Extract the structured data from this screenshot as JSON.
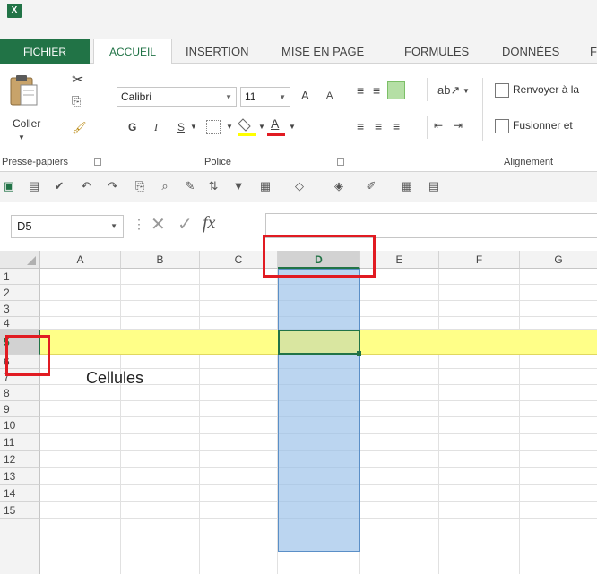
{
  "app": {
    "logo_text": "X"
  },
  "tabs": [
    {
      "label": "FICHIER"
    },
    {
      "label": "ACCUEIL"
    },
    {
      "label": "INSERTION"
    },
    {
      "label": "MISE EN PAGE"
    },
    {
      "label": "FORMULES"
    },
    {
      "label": "DONNÉES"
    },
    {
      "label": "F"
    }
  ],
  "ribbon": {
    "clipboard": {
      "paste_label": "Coller",
      "group_label": "Presse-papiers"
    },
    "font": {
      "font_name": "Calibri",
      "font_size": "11",
      "bold": "G",
      "italic": "I",
      "underline": "S",
      "group_label": "Police",
      "grow_font": "A",
      "shrink_font": "A",
      "font_color_glyph": "A"
    },
    "alignment": {
      "wrap_text": "Renvoyer à la",
      "merge_center": "Fusionner et",
      "group_label": "Alignement"
    }
  },
  "formula_bar": {
    "name_box": "D5",
    "fx_label": "fx",
    "formula_value": ""
  },
  "grid": {
    "columns": [
      "A",
      "B",
      "C",
      "D",
      "E",
      "F",
      "G"
    ],
    "rows": [
      "1",
      "2",
      "3",
      "4",
      "5",
      "6",
      "7",
      "8",
      "9",
      "10",
      "11",
      "12",
      "13",
      "14",
      "15"
    ],
    "active_cell": "D5",
    "annotation_text": "Cellules"
  },
  "colors": {
    "excel_green": "#217346",
    "column_highlight": "#b8d2ec",
    "row_highlight": "#ffff88",
    "callout_red": "#e11b22"
  }
}
